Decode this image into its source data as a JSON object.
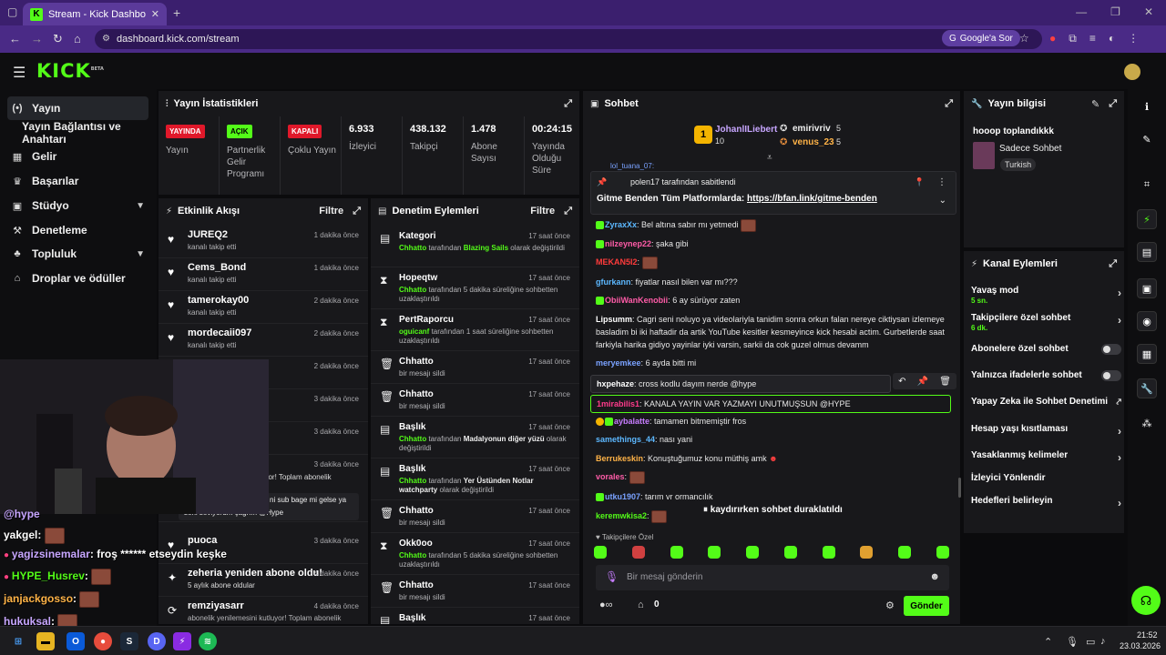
{
  "browser": {
    "tab_title": "Stream - Kick Dashboard",
    "tab_fav": "K",
    "url": "dashboard.kick.com/stream",
    "google_btn": "Google'a Sor"
  },
  "kick": {
    "logo": "KICK",
    "logo_sup": "BETA"
  },
  "sidebar": {
    "items": [
      {
        "icon": "(•)",
        "label": "Yayın"
      },
      {
        "icon": "",
        "label": "Yayın Bağlantısı ve Anahtarı"
      },
      {
        "icon": "▦",
        "label": "Gelir"
      },
      {
        "icon": "♛",
        "label": "Başarılar"
      },
      {
        "icon": "▣",
        "label": "Stüdyo"
      },
      {
        "icon": "⚒",
        "label": "Denetleme"
      },
      {
        "icon": "♣",
        "label": "Topluluk"
      },
      {
        "icon": "⌂",
        "label": "Droplar ve ödüller"
      }
    ]
  },
  "stats": {
    "title": "Yayın İstatistikleri",
    "cols": [
      {
        "badge": "YAYINDA",
        "label": "Yayın"
      },
      {
        "badge": "AÇIK",
        "label": "Partnerlik Gelir Programı"
      },
      {
        "badge": "KAPALI",
        "label": "Çoklu Yayın"
      },
      {
        "value": "6.933",
        "label": "İzleyici"
      },
      {
        "value": "438.132",
        "label": "Takipçi"
      },
      {
        "value": "1.478",
        "label": "Abone Sayısı"
      },
      {
        "value": "00:24:15",
        "label": "Yayında Olduğu Süre"
      }
    ]
  },
  "activity": {
    "title": "Etkinlik Akışı",
    "filter": "Filtre",
    "rows": [
      {
        "name": "JUREQ2",
        "sub": "kanalı takip etti",
        "time": "1 dakika önce"
      },
      {
        "name": "Cems_Bond",
        "sub": "kanalı takip etti",
        "time": "1 dakika önce"
      },
      {
        "name": "tamerokay00",
        "sub": "kanalı takip etti",
        "time": "2 dakika önce"
      },
      {
        "name": "mordecaii097",
        "sub": "kanalı takip etti",
        "time": "2 dakika önce"
      },
      {
        "time": "2 dakika önce"
      },
      {
        "time": "3 dakika önce"
      },
      {
        "time": "3 dakika önce"
      },
      {
        "time": "3 dakika önce"
      }
    ],
    "partial_1": "uyor! Toplam abonelik",
    "partial_2": "ni sub bage mi gelse ya",
    "partial_3": "seni seviyorum çağrım @Hype",
    "puoca": {
      "name": "puoca",
      "time": "3 dakika önce"
    },
    "zeheria": {
      "name": "zeheria yeniden abone oldu!",
      "sub": "5 aylık abone oldular",
      "time": "4 dakika önce"
    },
    "remzi": {
      "name": "remziyasarr",
      "sub": "abonelik yenilemesini kutluyor! Toplam abonelik",
      "time": "4 dakika önce"
    }
  },
  "moderation": {
    "title": "Denetim Eylemleri",
    "filter": "Filtre",
    "rows": [
      {
        "icon": "▤",
        "title": "Kategori",
        "time": "17 saat önce",
        "d1": "Chhatto",
        "d2": " tarafından ",
        "d3": "Blazing Sails",
        "d4": " olarak değiştirildi"
      },
      {
        "icon": "⧗",
        "title": "Hopeqtw",
        "time": "17 saat önce",
        "d1": "Chhatto",
        "d2": " tarafından 5 dakika süreliğine sohbetten uzaklaştırıldı"
      },
      {
        "icon": "⧗",
        "title": "PertRaporcu",
        "time": "17 saat önce",
        "d1": "oguicanf",
        "d2": " tarafından 1 saat süreliğine sohbetten uzaklaştırıldı"
      },
      {
        "icon": "🗑",
        "title": "Chhatto",
        "time": "17 saat önce",
        "d2": "bir mesajı sildi"
      },
      {
        "icon": "🗑",
        "title": "Chhatto",
        "time": "17 saat önce",
        "d2": "bir mesajı sildi"
      },
      {
        "icon": "▤",
        "title": "Başlık",
        "time": "17 saat önce",
        "d1": "Chhatto",
        "d2": " tarafından ",
        "d5": "Madalyonun diğer yüzü",
        "d4": " olarak değiştirildi"
      },
      {
        "icon": "▤",
        "title": "Başlık",
        "time": "17 saat önce",
        "d1": "Chhatto",
        "d2": " tarafından ",
        "d5": "Yer Üstünden Notlar watchparty",
        "d4": " olarak değiştirildi"
      },
      {
        "icon": "🗑",
        "title": "Chhatto",
        "time": "17 saat önce",
        "d2": "bir mesajı sildi"
      },
      {
        "icon": "⧗",
        "title": "Okk0oo",
        "time": "17 saat önce",
        "d1": "Chhatto",
        "d2": " tarafından 5 dakika süreliğine sohbetten uzaklaştırıldı"
      },
      {
        "icon": "🗑",
        "title": "Chhatto",
        "time": "17 saat önce",
        "d2": "bir mesajı sildi"
      },
      {
        "icon": "▤",
        "title": "Başlık",
        "time": "17 saat önce"
      }
    ]
  },
  "chat": {
    "title": "Sohbet",
    "leader": {
      "name": "JohanlILiebert",
      "pts": "10",
      "rank": "1"
    },
    "top2": {
      "name": "emirivriv",
      "pts": "5"
    },
    "top3": {
      "name": "venus_23",
      "pts": "5"
    },
    "peek": "lol_tuana_07:",
    "pinned_by": "polen17 tarafından sabitlendi",
    "pinned_text": "Gitme Benden Tüm Platformlarda: ",
    "pinned_link": "https://bfan.link/gitme-benden",
    "messages": [
      {
        "u": "ZyraxXx",
        "c": "#5cb8ff",
        "t": "Bel altına sabır mı yetmedi"
      },
      {
        "u": "nilzeyneр22",
        "c": "#ff5ca8",
        "t": "şaka gibi"
      },
      {
        "u": "MEKAN5I2",
        "c": "#ff3b3b",
        "t": ""
      },
      {
        "u": "gfurkann",
        "c": "#5cb8ff",
        "t": "fiyatlar nasıl bilen var mı???"
      },
      {
        "u": "ObiiWanKenobii",
        "c": "#ff5ca8",
        "t": "6 ay sürüyor zaten"
      },
      {
        "u": "Lipsumm",
        "c": "#fff",
        "t": "Cagri seni noluyo ya videolariyla tanidim sonra orkun falan nereye ciktiysan izlemeye basladim bi iki haftadir da artik YouTube kesitler kesmeyince kick hesabi actim. Gurbetlerde saat farkiyla harika gidiyo yayinlar iyki varsin, sarkii da cok guzel olmus devamm"
      },
      {
        "u": "meryemkee",
        "c": "#7aa2ff",
        "t": "6 ayda bitti mi"
      },
      {
        "u": "hxpehaze",
        "c": "#fff",
        "t": "cross kodlu dayım nerde @hype"
      },
      {
        "u": "1mirabilis1",
        "c": "#ff3b8b",
        "t": "KANALA YAYIN VAR YAZMAYI UNUTMUŞSUN @HYPE"
      },
      {
        "u": "aybalatte",
        "c": "#c77dff",
        "t": "tamamen bitmemiştir fros"
      },
      {
        "u": "samethings_44",
        "c": "#5cb8ff",
        "t": "nası yani"
      },
      {
        "u": "Berrukeskin",
        "c": "#ffb347",
        "t": "Konuştuğumuz konu müthiş amk"
      },
      {
        "u": "vorales",
        "c": "#ff5ca8",
        "t": ""
      },
      {
        "u": "utku1907",
        "c": "#7aa2ff",
        "t": "tarım vr ormancılık"
      },
      {
        "u": "keremwkisa2",
        "c": "#53fc18",
        "t": ""
      }
    ],
    "paused": "kaydırırken sohbet duraklatıldı",
    "followers_only": "Takipçilere Özel",
    "input_placeholder": "Bir mesaj gönderin",
    "count": "0",
    "send": "Gönder"
  },
  "stream_info": {
    "title": "Yayın bilgisi",
    "stream_title": "hooop toplandıkkk",
    "category": "Sadece Sohbet",
    "lang": "Turkish"
  },
  "channel_actions": {
    "title": "Kanal Eylemleri",
    "items": [
      {
        "label": "Yavaş mod",
        "sub": "5 sn.",
        "kind": "chev"
      },
      {
        "label": "Takipçilere özel sohbet",
        "sub": "6 dk.",
        "kind": "chev"
      },
      {
        "label": "Abonelere özel sohbet",
        "kind": "toggle"
      },
      {
        "label": "Yalnızca ifadelerle sohbet",
        "kind": "toggle"
      },
      {
        "label": "Yapay Zeka ile Sohbet Denetimi",
        "kind": "ext"
      },
      {
        "label": "Hesap yaşı kısıtlaması",
        "kind": "chev"
      },
      {
        "label": "Yasaklanmış kelimeler",
        "kind": "chev"
      },
      {
        "label": "İzleyici Yönlendir",
        "kind": "none"
      },
      {
        "label": "Hedefleri belirleyin",
        "kind": "chev"
      }
    ]
  },
  "overlay_chat": [
    {
      "u": "@hype",
      "t": ""
    },
    {
      "u": "yakgel",
      "t": ":",
      "c": "#ffffff"
    },
    {
      "u": "yagizsinemalar",
      "t": ": froş ****** etseydin keşke",
      "c": "#c7a6ff"
    },
    {
      "u": "HYPE_Husrev",
      "t": ":",
      "c": "#53fc18"
    },
    {
      "u": "janjackgosso",
      "t": ":",
      "c": "#ffb347"
    },
    {
      "u": "hukuksal",
      "t": ":",
      "c": "#c7a6ff"
    }
  ],
  "taskbar": {
    "time": "21:52",
    "date": "23.03.2026"
  }
}
